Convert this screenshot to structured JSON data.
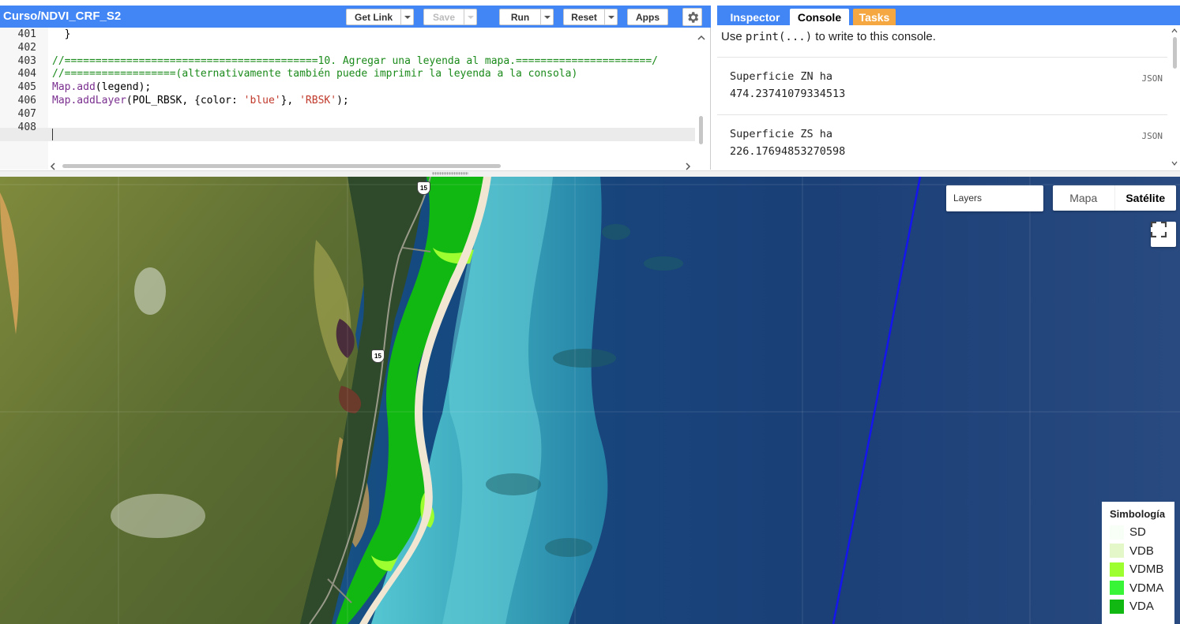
{
  "editor": {
    "script_title": "Curso/NDVI_CRF_S2",
    "buttons": {
      "get_link": "Get Link",
      "save": "Save",
      "run": "Run",
      "reset": "Reset",
      "apps": "Apps"
    },
    "lines": [
      {
        "number": "401",
        "text": "  }"
      },
      {
        "number": "402",
        "text": ""
      },
      {
        "number": "403",
        "text": "//=========================================10. Agregar una leyenda al mapa.======================/"
      },
      {
        "number": "404",
        "text": "//==================(alternativamente también puede imprimir la leyenda a la consola)"
      },
      {
        "number": "405",
        "fn": "Map.add",
        "rest": "(legend);"
      },
      {
        "number": "406",
        "fn": "Map.addLayer",
        "p1": "(POL_RBSK, {color: ",
        "s1": "'blue'",
        "p2": "}, ",
        "s2": "'RBSK'",
        "p3": ");"
      },
      {
        "number": "407",
        "text": ""
      },
      {
        "number": "408",
        "text": ""
      }
    ]
  },
  "console": {
    "tabs": {
      "inspector": "Inspector",
      "console": "Console",
      "tasks": "Tasks"
    },
    "hint_prefix": "Use ",
    "hint_code": "print(...)",
    "hint_suffix": " to write to this console.",
    "entries": [
      {
        "label": "Superficie ZN ha",
        "value": "474.23741079334513",
        "json": "JSON"
      },
      {
        "label": "Superficie ZS ha",
        "value": "226.17694853270598",
        "json": "JSON"
      }
    ]
  },
  "map": {
    "layers_label": "Layers",
    "map_types": {
      "mapa": "Mapa",
      "satelite": "Satélite",
      "selected": "Satélite"
    },
    "road_shield": "15",
    "legend": {
      "title": "Simbología",
      "items": [
        {
          "label": "SD",
          "color": "#f7fff7"
        },
        {
          "label": "VDB",
          "color": "#e3f7c9"
        },
        {
          "label": "VDMB",
          "color": "#9dff2f"
        },
        {
          "label": "VDMA",
          "color": "#38f538"
        },
        {
          "label": "VDA",
          "color": "#12b812"
        }
      ]
    }
  }
}
